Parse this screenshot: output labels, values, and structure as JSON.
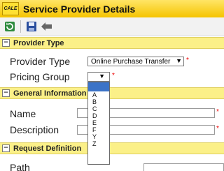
{
  "window": {
    "logo_text": "CALE",
    "title": "Service Provider Details"
  },
  "toolbar": {
    "buttons": [
      "refresh-icon",
      "save-icon",
      "back-arrow-icon"
    ]
  },
  "sections": {
    "provider_type": {
      "collapse_symbol": "−",
      "title": "Provider Type"
    },
    "general": {
      "collapse_symbol": "−",
      "title": "General Information"
    },
    "request": {
      "collapse_symbol": "−",
      "title": "Request Definition"
    }
  },
  "fields": {
    "provider_type": {
      "label": "Provider Type",
      "value": "Online Purchase Transfer",
      "required": "*"
    },
    "pricing_group": {
      "label": "Pricing Group",
      "value": "",
      "required": "*",
      "options": [
        "",
        "A",
        "B",
        "C",
        "D",
        "E",
        "F",
        "Y",
        "Z"
      ]
    },
    "name": {
      "label": "Name",
      "value": "",
      "required": "*"
    },
    "description": {
      "label": "Description",
      "value": "",
      "required": "*"
    },
    "path": {
      "label": "Path",
      "value": ""
    }
  },
  "colors": {
    "titlebar": "#f5c400",
    "section_header": "#fbf088",
    "selected_option": "#3b73c7",
    "required": "#e00000"
  }
}
